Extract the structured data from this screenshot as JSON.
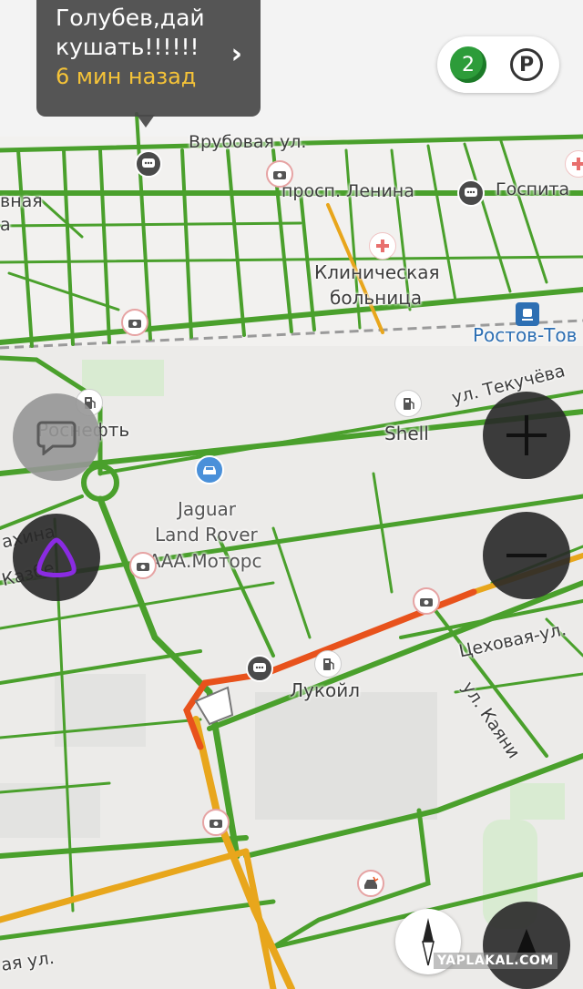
{
  "notification": {
    "line1": "Голубев,дай",
    "line2": "кушать!!!!!!",
    "time": "6 мин назад",
    "chevron": "›"
  },
  "controls": {
    "traffic_level": "2",
    "parking_symbol": "P"
  },
  "labels": {
    "vrubovaya": "Врубовая ул.",
    "lenina": "просп. Ленина",
    "gospital": "Госпита",
    "clinic_1": "Клиническая",
    "clinic_2": "больница",
    "left_top_1": "вная",
    "left_top_2": "а",
    "rostov": "Ростов-Тов",
    "tekuch": "ул. Текучёва",
    "rosneft": "Роснефть",
    "shell": "Shell",
    "jaguar_1": "Jaguar",
    "jaguar_2": "Land Rover",
    "jaguar_3": "ААА.Моторс",
    "mahina": "ахина",
    "kazbek": "Казбе",
    "tsekh": "Цеховая-ул.",
    "lukoil": "Лукойл",
    "kayani": "ул. Каяни",
    "bottom_left": "ая ул.",
    "watermark": "YAPLAKAL.COM"
  },
  "icons": {
    "camera": "camera-icon",
    "talk": "chat-bubble-icon",
    "fuel": "fuel-icon",
    "medical": "medical-cross-icon",
    "car_dealer": "car-icon",
    "train": "train-icon",
    "accident": "accident-icon",
    "alice": "alice-assistant-icon",
    "zoom_in": "plus-icon",
    "zoom_out": "minus-icon",
    "compass": "compass-icon",
    "navigation": "navigation-arrow-icon"
  },
  "colors": {
    "map_bg": "#ecebe9",
    "road_free": "#4aa02c",
    "road_slow": "#e8a61c",
    "road_jam": "#e8521c",
    "accent_yellow": "#f5c338",
    "alice_purple": "#8a2be2"
  }
}
